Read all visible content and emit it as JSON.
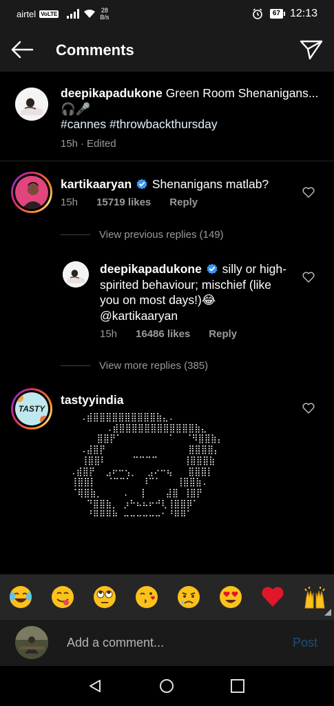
{
  "status_bar": {
    "carrier": "airtel",
    "network_badge": "VoLTE",
    "data_speed_value": "28",
    "data_speed_unit": "B/s",
    "battery": "67",
    "time": "12:13"
  },
  "header": {
    "title": "Comments"
  },
  "caption": {
    "username": "deepikapadukone",
    "text": " Green Room Shenanigans...🎧🎤 ",
    "hashtags": "#cannes #throwbackthursday",
    "time": "15h",
    "edited": "Edited",
    "separator": "·"
  },
  "comments": [
    {
      "username": "kartikaaryan",
      "text": " Shenanigans matlab?",
      "time": "15h",
      "likes": "15719 likes",
      "reply_label": "Reply",
      "view_previous": "View previous replies (149)"
    },
    {
      "username": "deepikapadukone",
      "text": " silly or high-spirited behaviour; mischief (like you on most days!)😂 @kartikaaryan",
      "time": "15h",
      "likes": "16486 likes",
      "reply_label": "Reply",
      "view_more": "View more replies (385)"
    },
    {
      "username": "tastyyindia",
      "avatar_text": "TASTY"
    }
  ],
  "emoji_bar": {
    "emojis": [
      "face-with-tears-of-joy",
      "face-savoring-food",
      "face-with-rolling-eyes",
      "face-blowing-kiss",
      "crying-face",
      "heart-eyes",
      "red-heart",
      "raising-hands"
    ]
  },
  "comment_input": {
    "placeholder": "Add a comment...",
    "post_label": "Post"
  },
  "colors": {
    "background": "#000000",
    "bar": "#1a1a1a",
    "emoji_bar": "#262626",
    "muted_text": "#9a9a9a",
    "post_disabled": "#1f4e7a",
    "verified": "#3897f0",
    "heart_red": "#e0162b"
  }
}
